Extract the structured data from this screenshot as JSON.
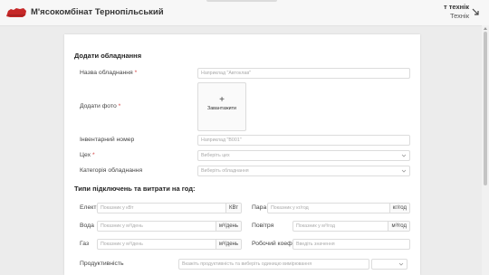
{
  "header": {
    "brand": "М'ясокомбінат Тернопільський",
    "user_name": "т технік",
    "user_role": "Технік"
  },
  "form": {
    "section1_title": "Додати обладнання",
    "name": {
      "label": "Назва обладнання",
      "placeholder": "Наприклад \"Автоклав\""
    },
    "photo": {
      "label": "Додати фото",
      "upload_label": "Завантажити"
    },
    "inventory": {
      "label": "Інвентарний номер",
      "placeholder": "Наприклад \"B001\""
    },
    "workshop": {
      "label": "Цех",
      "placeholder": "Виберіть цех"
    },
    "category": {
      "label": "Категорія обладнання",
      "placeholder": "Виберіть обладнання"
    },
    "section2_title": "Типи підключень та витрати на год:",
    "electricity": {
      "label": "Електроенергія",
      "placeholder": "Показник у кВт",
      "unit": "КВт"
    },
    "steam": {
      "label": "Пара",
      "placeholder": "Показник у кг/год",
      "unit": "кг/год"
    },
    "water": {
      "label": "Вода",
      "placeholder": "Показник у м³/день",
      "unit": "м³/день"
    },
    "air": {
      "label": "Повітря",
      "placeholder": "Показник у м³/год",
      "unit": "м³/год"
    },
    "gas": {
      "label": "Газ",
      "placeholder": "Показник у м³/день",
      "unit": "м³/день"
    },
    "work_coef": {
      "label": "Робочий коеф.",
      "placeholder": "Введіть значення"
    },
    "productivity": {
      "label": "Продуктивність",
      "placeholder": "Вкажіть продуктивність та виберіть одиницю вимірювання"
    }
  },
  "colors": {
    "accent": "#c62828",
    "required": "#d23b3b"
  }
}
